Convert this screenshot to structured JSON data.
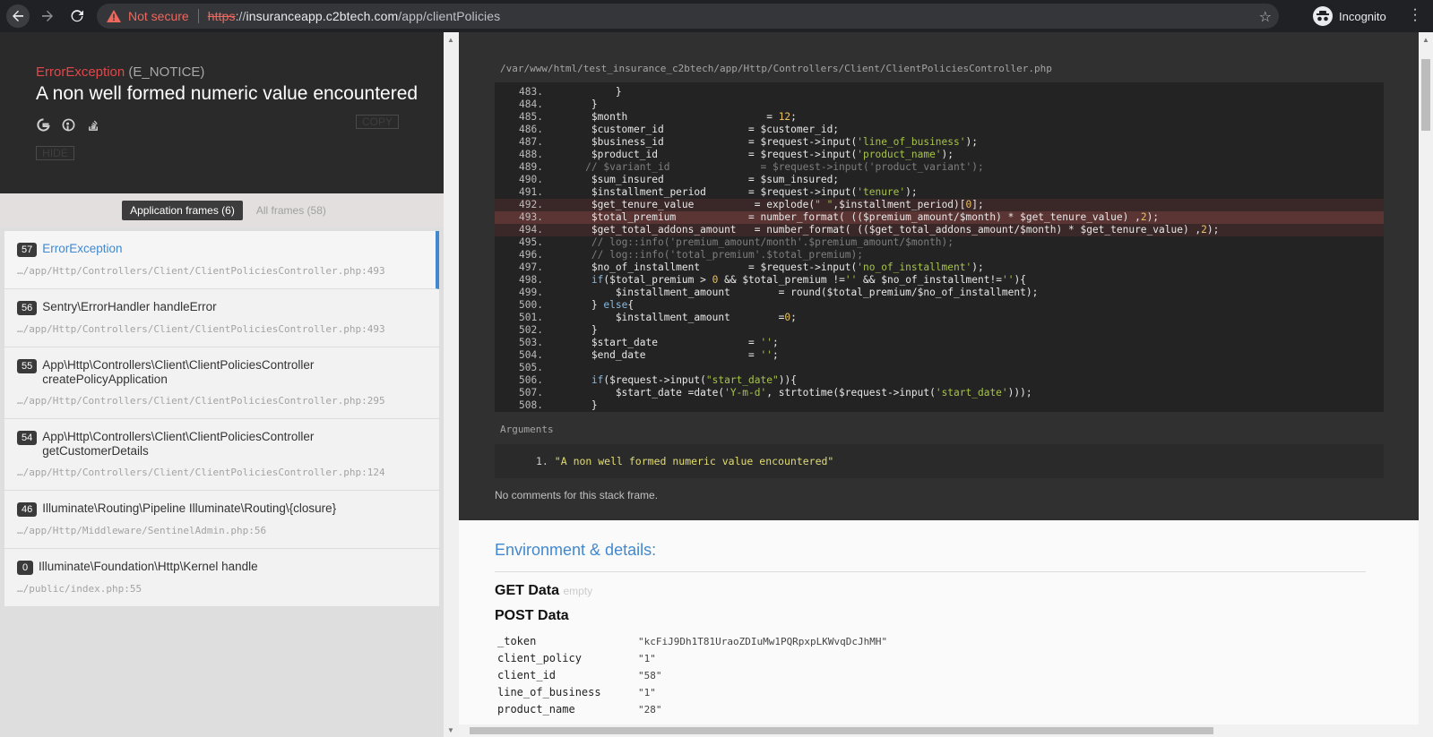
{
  "browser": {
    "security_label": "Not secure",
    "url_scheme": "https",
    "url_sep": "://",
    "url_host": "insuranceapp.c2btech.com",
    "url_path": "/app/clientPolicies",
    "profile_label": "Incognito"
  },
  "error": {
    "class_name": "ErrorException",
    "code": "(E_NOTICE)",
    "message": "A non well formed numeric value encountered",
    "copy_label": "COPY",
    "hide_label": "HIDE"
  },
  "filters": {
    "app_frames": "Application frames (6)",
    "all_frames": "All frames (58)"
  },
  "frames": [
    {
      "num": "57",
      "cls": "ErrorException",
      "cls2": "",
      "file": "…/app/Http/Controllers/Client/ClientPoliciesController.php:493",
      "active": true
    },
    {
      "num": "56",
      "cls": "Sentry\\ErrorHandler handleError",
      "cls2": "",
      "file": "…/app/Http/Controllers/Client/ClientPoliciesController.php:493",
      "active": false
    },
    {
      "num": "55",
      "cls": "App\\Http\\Controllers\\Client\\ClientPoliciesController",
      "cls2": "createPolicyApplication",
      "file": "…/app/Http/Controllers/Client/ClientPoliciesController.php:295",
      "active": false
    },
    {
      "num": "54",
      "cls": "App\\Http\\Controllers\\Client\\ClientPoliciesController",
      "cls2": "getCustomerDetails",
      "file": "…/app/Http/Controllers/Client/ClientPoliciesController.php:124",
      "active": false
    },
    {
      "num": "46",
      "cls": "Illuminate\\Routing\\Pipeline Illuminate\\Routing\\{closure}",
      "cls2": "",
      "file": "…/app/Http/Middleware/SentinelAdmin.php:56",
      "active": false
    },
    {
      "num": "0",
      "cls": "Illuminate\\Foundation\\Http\\Kernel handle",
      "cls2": "",
      "file": "…/public/index.php:55",
      "active": false
    }
  ],
  "code_panel": {
    "file_path": "/var/www/html/test_insurance_c2btech/app/Http/Controllers/Client/ClientPoliciesController.php",
    "lines": [
      {
        "n": "483.",
        "html": "            }",
        "hl": ""
      },
      {
        "n": "484.",
        "html": "        }",
        "hl": ""
      },
      {
        "n": "485.",
        "html": "        $month                       = <span class=\"c-num\">12</span>;",
        "hl": ""
      },
      {
        "n": "486.",
        "html": "        $customer_id              = $customer_id;",
        "hl": ""
      },
      {
        "n": "487.",
        "html": "        $business_id              = $request-&gt;input(<span class=\"c-str\">'line_of_business'</span>);",
        "hl": ""
      },
      {
        "n": "488.",
        "html": "        $product_id               = $request-&gt;input(<span class=\"c-str\">'product_name'</span>);",
        "hl": ""
      },
      {
        "n": "489.",
        "html": "       <span class=\"c-cm\">// $variant_id               = $request-&gt;input('product_variant');</span>",
        "hl": ""
      },
      {
        "n": "490.",
        "html": "        $sum_insured              = $sum_insured;",
        "hl": ""
      },
      {
        "n": "491.",
        "html": "        $installment_period       = $request-&gt;input(<span class=\"c-str\">'tenure'</span>);",
        "hl": ""
      },
      {
        "n": "492.",
        "html": "        $get_tenure_value          = explode(<span class=\"c-str\">\" \"</span>,$installment_period)[<span class=\"c-num\">0</span>];",
        "hl": "hl"
      },
      {
        "n": "493.",
        "html": "        $total_premium            = number_format( (($premium_amount/$month) * $get_tenure_value) ,<span class=\"c-num\">2</span>);",
        "hl": "hl-strong"
      },
      {
        "n": "494.",
        "html": "        $get_total_addons_amount   = number_format( (($get_total_addons_amount/$month) * $get_tenure_value) ,<span class=\"c-num\">2</span>);",
        "hl": "hl"
      },
      {
        "n": "495.",
        "html": "        <span class=\"c-cm\">// log::info('premium_amount/month'.$premium_amount/$month);</span>",
        "hl": ""
      },
      {
        "n": "496.",
        "html": "        <span class=\"c-cm\">// log::info('total_premium'.$total_premium);</span>",
        "hl": ""
      },
      {
        "n": "497.",
        "html": "        $no_of_installment        = $request-&gt;input(<span class=\"c-str\">'no_of_installment'</span>);",
        "hl": ""
      },
      {
        "n": "498.",
        "html": "        <span class=\"c-kw\">if</span>($total_premium &gt; <span class=\"c-num\">0</span> &amp;&amp; $total_premium !=<span class=\"c-str\">''</span> &amp;&amp; $no_of_installment!=<span class=\"c-str\">''</span>){",
        "hl": ""
      },
      {
        "n": "499.",
        "html": "            $installment_amount        = round($total_premium/$no_of_installment);",
        "hl": ""
      },
      {
        "n": "500.",
        "html": "        } <span class=\"c-kw\">else</span>{",
        "hl": ""
      },
      {
        "n": "501.",
        "html": "            $installment_amount        =<span class=\"c-num\">0</span>;",
        "hl": ""
      },
      {
        "n": "502.",
        "html": "        }",
        "hl": ""
      },
      {
        "n": "503.",
        "html": "        $start_date               = <span class=\"c-str\">''</span>;",
        "hl": ""
      },
      {
        "n": "504.",
        "html": "        $end_date                 = <span class=\"c-str\">''</span>;",
        "hl": ""
      },
      {
        "n": "505.",
        "html": "",
        "hl": ""
      },
      {
        "n": "506.",
        "html": "        <span class=\"c-kw\">if</span>($request-&gt;input(<span class=\"c-str\">\"start_date\"</span>)){",
        "hl": ""
      },
      {
        "n": "507.",
        "html": "            $start_date =date(<span class=\"c-str\">'Y-m-d'</span>, strtotime($request-&gt;input(<span class=\"c-str\">'start_date'</span>)));",
        "hl": ""
      },
      {
        "n": "508.",
        "html": "        }",
        "hl": ""
      }
    ],
    "arguments_label": "Arguments",
    "argument_index": "1.",
    "argument_value": "\"A non well formed numeric value encountered\"",
    "no_comments": "No comments for this stack frame."
  },
  "environment": {
    "title": "Environment & details:",
    "get_label": "GET Data",
    "get_empty": "empty",
    "post_label": "POST Data",
    "post_rows": [
      {
        "k": "_token",
        "v": "\"kcFiJ9Dh1T81UraoZDIuMw1PQRpxpLKWvqDcJhMH\""
      },
      {
        "k": "client_policy",
        "v": "\"1\""
      },
      {
        "k": "client_id",
        "v": "\"58\""
      },
      {
        "k": "line_of_business",
        "v": "\"1\""
      },
      {
        "k": "product_name",
        "v": "\"28\""
      }
    ]
  }
}
